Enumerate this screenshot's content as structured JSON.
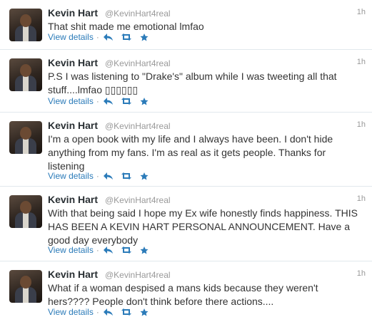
{
  "icons": {
    "reply": "reply-icon",
    "retweet": "retweet-icon",
    "favorite": "star-icon"
  },
  "colors": {
    "link": "#2b7bb9",
    "muted": "#999999",
    "divider": "#e1e8ed"
  },
  "tweets": [
    {
      "name": "Kevin Hart",
      "handle": "@KevinHart4real",
      "time": "1h",
      "text": "That shit made me emotional lmfao",
      "details_label": "View details",
      "dot": "·"
    },
    {
      "name": "Kevin Hart",
      "handle": "@KevinHart4real",
      "time": "1h",
      "text": "P.S I was listening to \"Drake's\" album while I was tweeting all that stuff....lmfao ▯▯▯▯▯▯",
      "details_label": "View details",
      "dot": "·"
    },
    {
      "name": "Kevin Hart",
      "handle": "@KevinHart4real",
      "time": "1h",
      "text": "I'm a open book with my life and I always have been. I don't hide anything from my fans. I'm as real as it gets people. Thanks for listening",
      "details_label": "View details",
      "dot": "·"
    },
    {
      "name": "Kevin Hart",
      "handle": "@KevinHart4real",
      "time": "1h",
      "text": "With that being said I hope my Ex wife honestly finds happiness. THIS HAS BEEN A KEVIN HART PERSONAL ANNOUNCEMENT. Have a good day everybody",
      "details_label": "View details",
      "dot": "·"
    },
    {
      "name": "Kevin Hart",
      "handle": "@KevinHart4real",
      "time": "1h",
      "text": "What if a woman despised a mans kids because they weren't hers???? People don't think before there actions....",
      "details_label": "View details",
      "dot": "·"
    }
  ]
}
